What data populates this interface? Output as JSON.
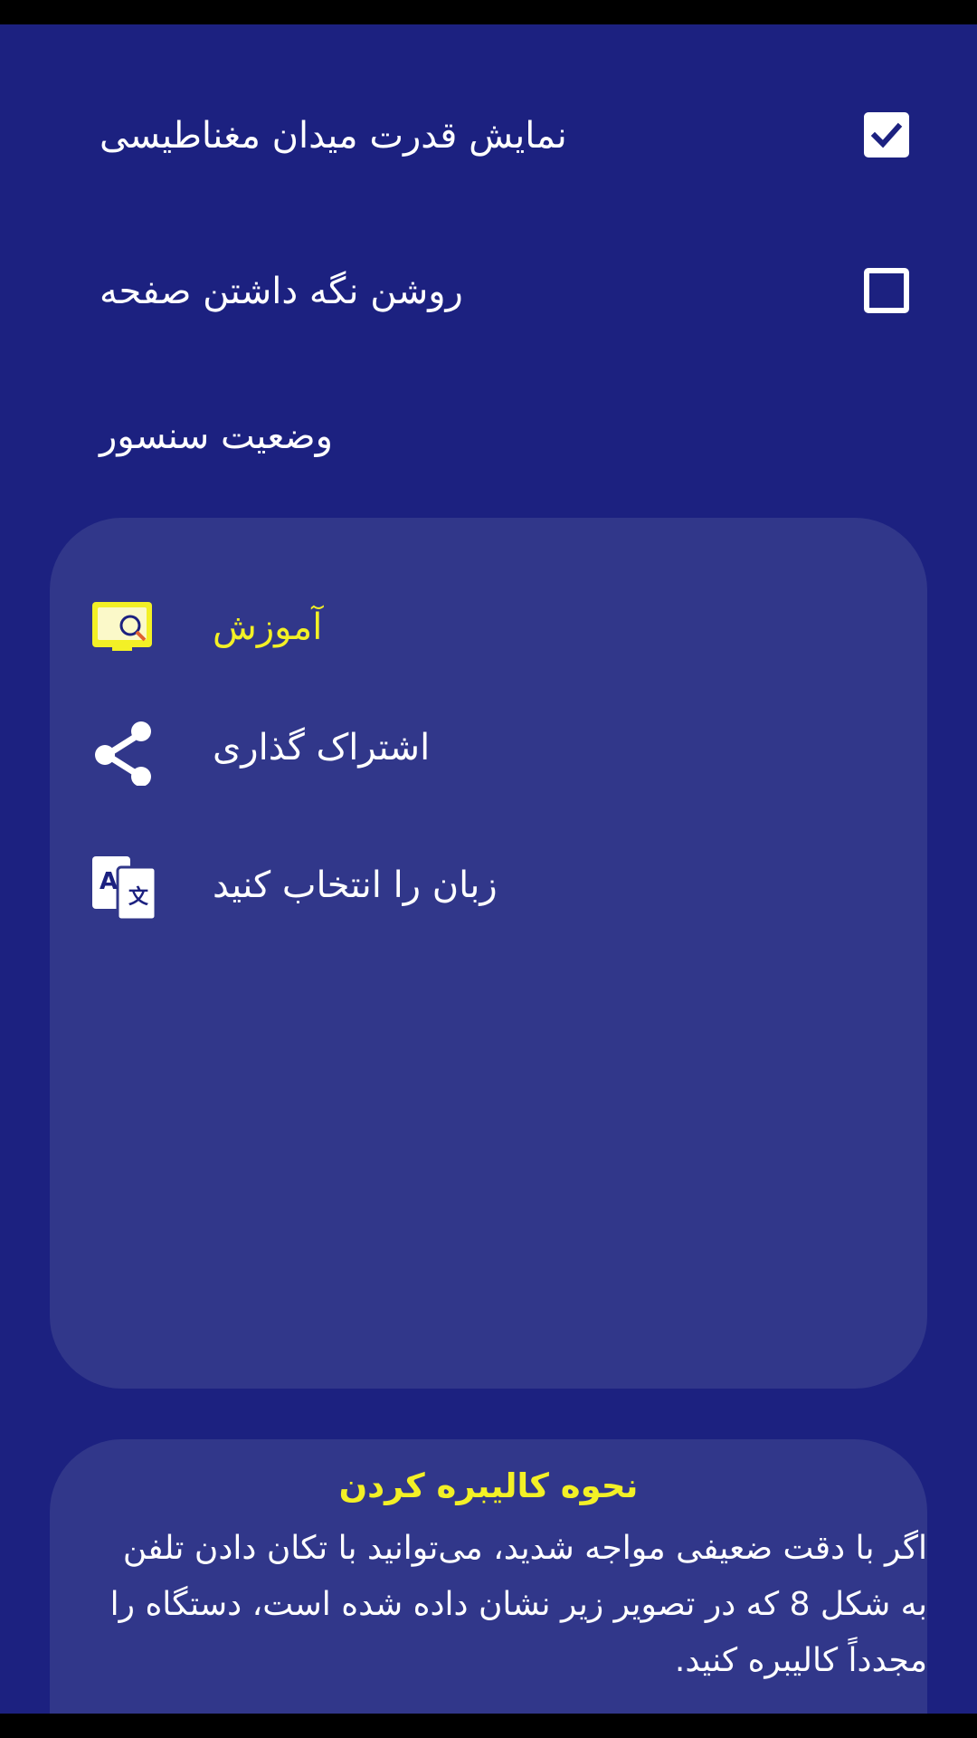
{
  "settings": [
    {
      "label": "نمایش قدرت میدان مغناطیسی",
      "checked": true
    },
    {
      "label": "روشن نگه داشتن صفحه",
      "checked": false
    },
    {
      "label": "وضعیت سنسور"
    }
  ],
  "menu": {
    "items": [
      {
        "label": "آموزش",
        "icon": "tutorial-book-icon",
        "highlight": true
      },
      {
        "label": "اشتراک گذاری",
        "icon": "share-icon"
      },
      {
        "label": "زبان را انتخاب کنید",
        "icon": "translate-icon"
      }
    ]
  },
  "calibration": {
    "title": "نحوه کالیبره کردن",
    "body": "اگر با دقت ضعیفی مواجه شدید، می‌توانید با تکان دادن تلفن\nبه شکل 8 که در تصویر زیر نشان داده شده است، دستگاه را\nمجدداً کالیبره کنید."
  },
  "colors": {
    "background": "#1c2180",
    "card": "#31378a",
    "accent_yellow": "#f3f026",
    "text": "#ffffff"
  }
}
